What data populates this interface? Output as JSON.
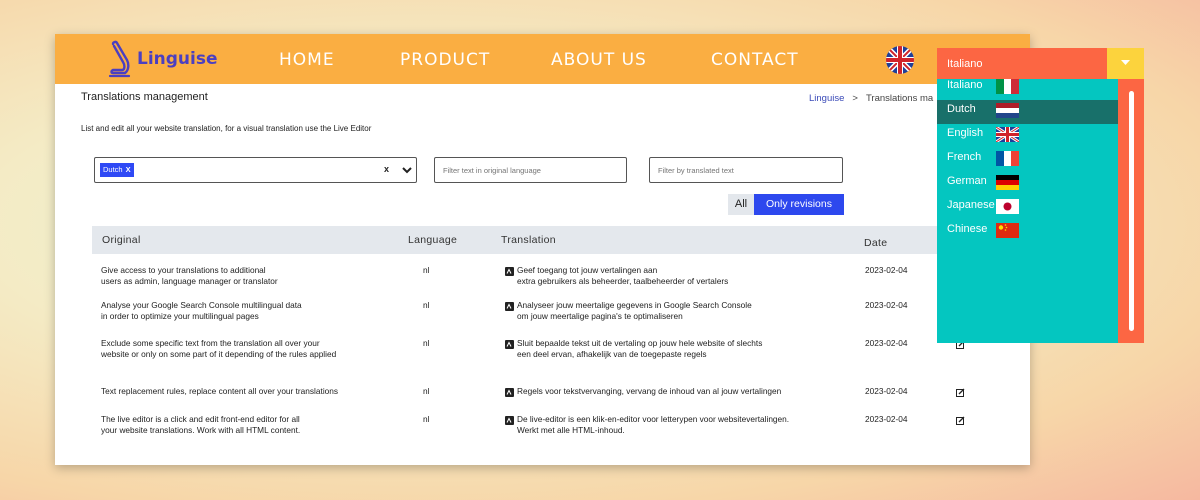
{
  "brand": {
    "name": "Linguise",
    "logo_icon": "linguise-logo-icon",
    "logo_color": "#4b3fc1"
  },
  "nav": {
    "items": [
      "HOME",
      "PRODUCT",
      "ABOUT US",
      "CONTACT"
    ],
    "background": "#faae42",
    "flag_icon": "uk-flag-icon"
  },
  "page": {
    "title": "Translations management",
    "subtitle": "List and edit all your website translation, for a visual translation use the Live Editor",
    "breadcrumb": {
      "home": "Linguise",
      "separator": ">",
      "current": "Translations ma"
    }
  },
  "filters": {
    "language_chip": "Dutch",
    "chip_remove": "X",
    "clear": "x",
    "original_placeholder": "Filter text in original language",
    "translated_placeholder": "Filter by translated text"
  },
  "toggle": {
    "all": "All",
    "revisions": "Only revisions",
    "active_color": "#2d48ee"
  },
  "table": {
    "headers": {
      "original": "Original",
      "language": "Language",
      "translation": "Translation",
      "date": "Date"
    },
    "rows": [
      {
        "original": [
          "Give access to your translations to additional",
          "users as admin, language manager or translator"
        ],
        "language": "nl",
        "translation": [
          "Geef toegang tot jouw vertalingen aan",
          "extra gebruikers als beheerder, taalbeheerder of vertalers"
        ],
        "date": "2023-02-04"
      },
      {
        "original": [
          "Analyse your Google Search Console multilingual data",
          "in order to optimize your multilingual pages"
        ],
        "language": "nl",
        "translation": [
          "Analyseer jouw meertalige gegevens in Google Search Console",
          "om jouw meertalige pagina's te optimaliseren"
        ],
        "date": "2023-02-04"
      },
      {
        "original": [
          "Exclude some specific text from the translation all over your",
          "website or only on some part of it depending of the rules applied"
        ],
        "language": "nl",
        "translation": [
          "Sluit bepaalde tekst uit de vertaling op jouw hele website of slechts",
          "een deel ervan, afhakelijk van de toegepaste regels"
        ],
        "date": "2023-02-04"
      },
      {
        "original": [
          "Text replacement rules, replace content all over your translations",
          ""
        ],
        "language": "nl",
        "translation": [
          "Regels voor tekstvervanging, vervang de inhoud van al jouw vertalingen",
          ""
        ],
        "date": "2023-02-04"
      },
      {
        "original": [
          "The live editor is a click and edit front-end editor for all",
          "your website translations. Work with all HTML content."
        ],
        "language": "nl",
        "translation": [
          "De live-editor is een klik-en-editor voor letterypen voor websitevertalingen.",
          "Werkt met alle HTML-inhoud."
        ],
        "date": "2023-02-04"
      }
    ]
  },
  "language_dropdown": {
    "selected": "Italiano",
    "header_color": "#fc6643",
    "list_color": "#04c6c0",
    "active_color": "#18706a",
    "options": [
      {
        "label": "Italiano",
        "flag": "italy-flag-icon"
      },
      {
        "label": "Dutch",
        "flag": "netherlands-flag-icon"
      },
      {
        "label": "English",
        "flag": "uk-flag-icon"
      },
      {
        "label": "French",
        "flag": "france-flag-icon"
      },
      {
        "label": "German",
        "flag": "germany-flag-icon"
      },
      {
        "label": "Japanese",
        "flag": "japan-flag-icon"
      },
      {
        "label": "Chinese",
        "flag": "china-flag-icon"
      }
    ],
    "active_index": 1
  }
}
